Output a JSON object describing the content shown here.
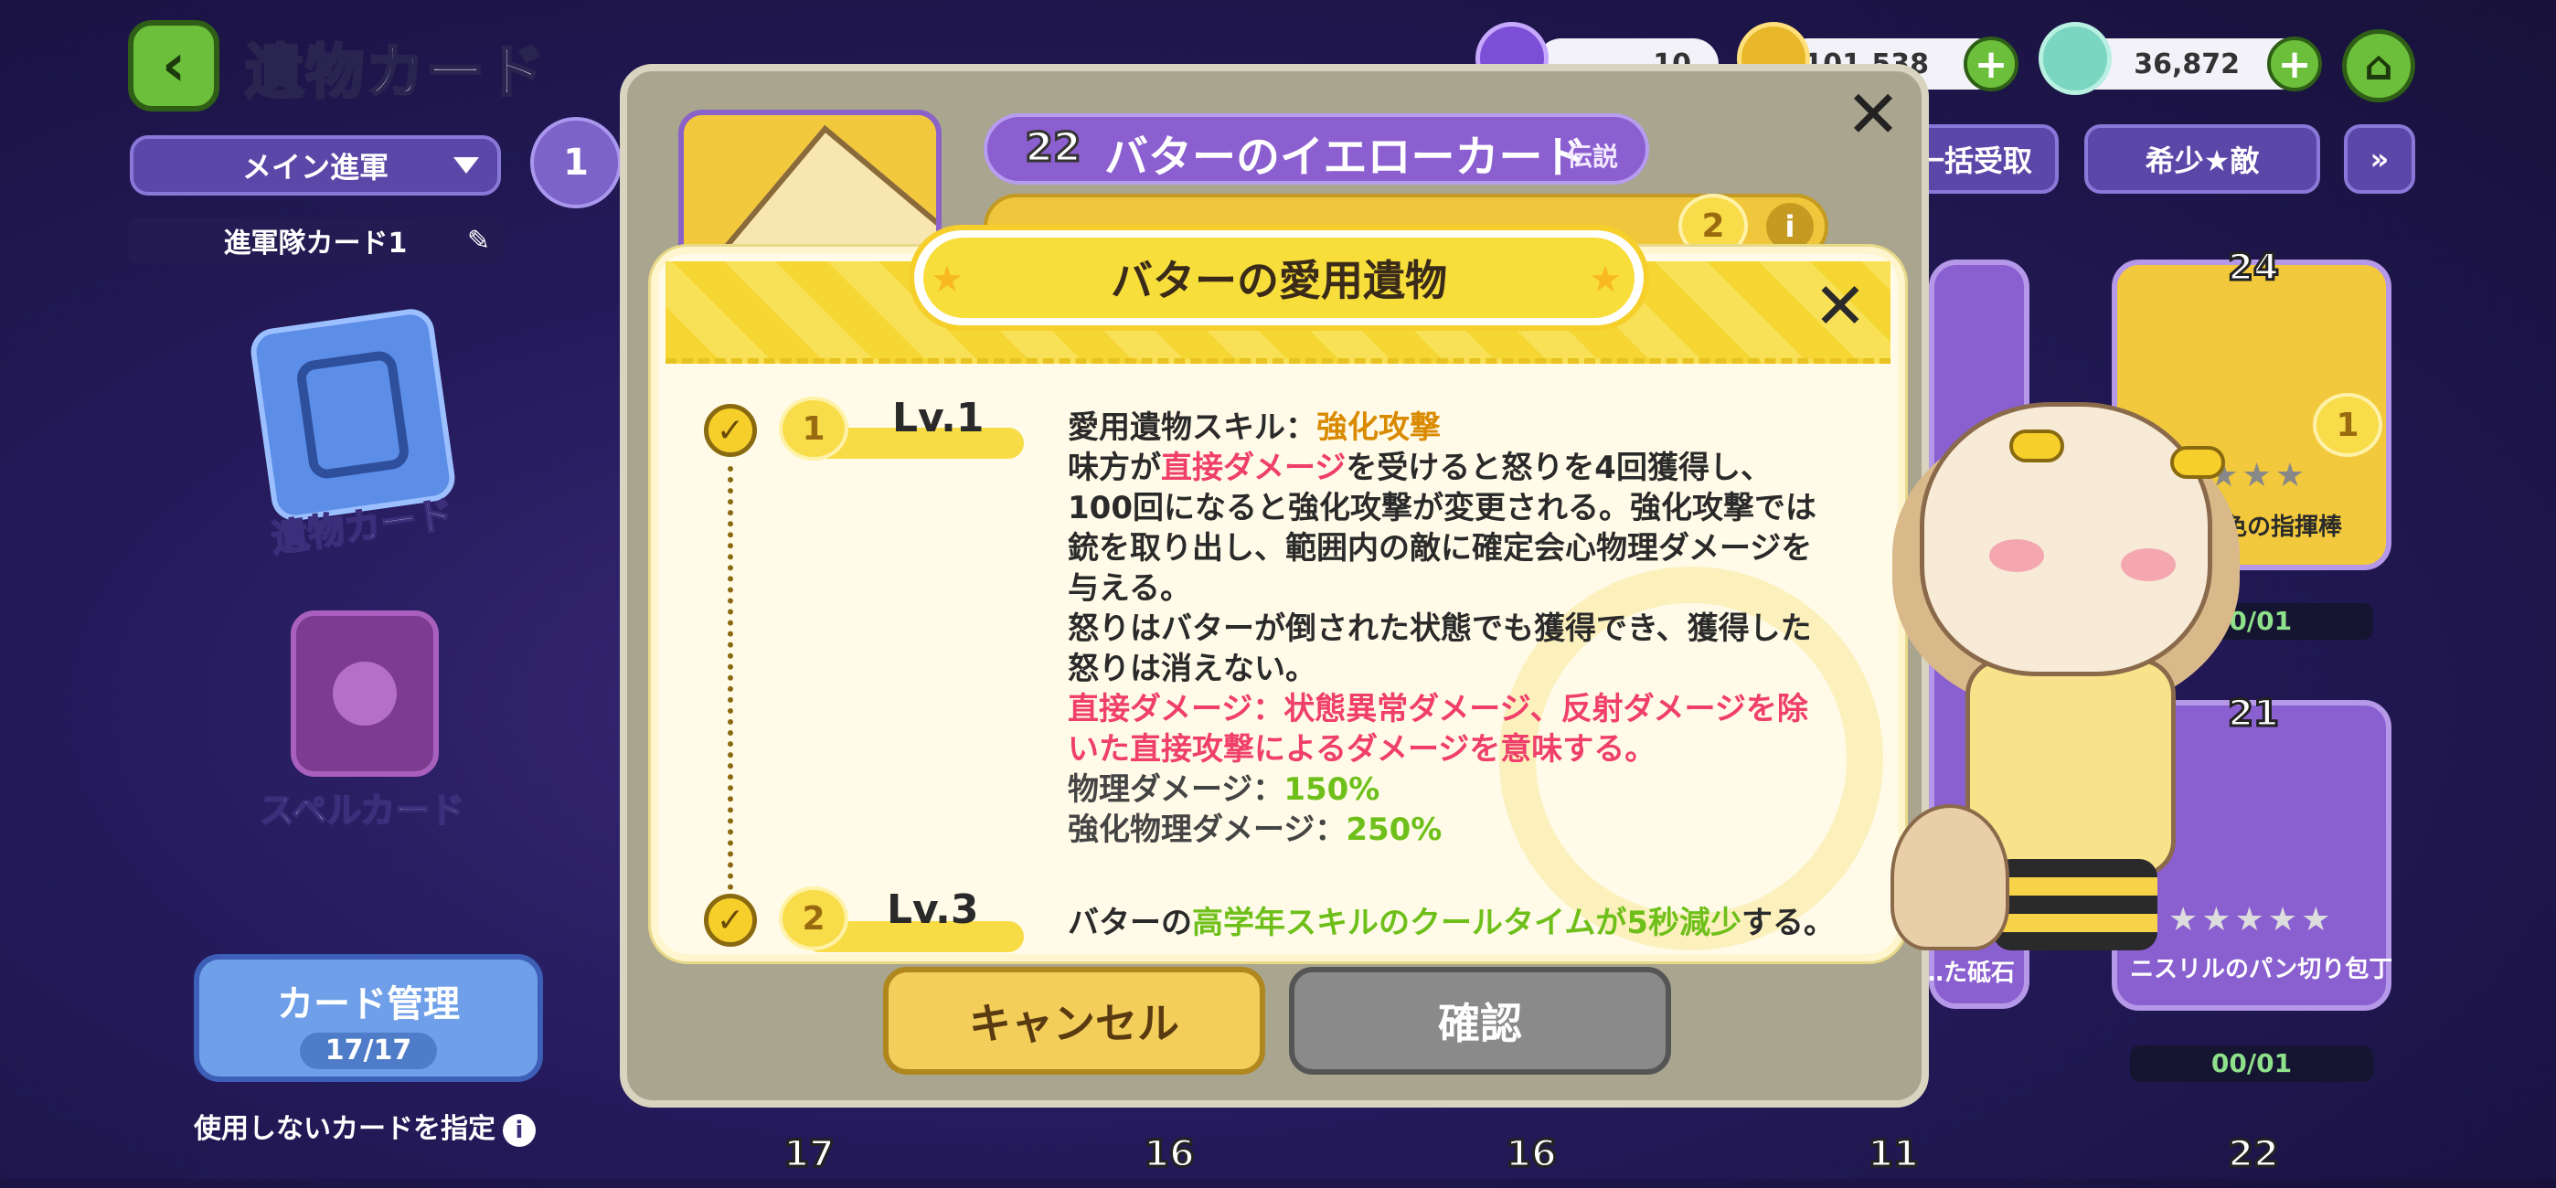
{
  "header": {
    "title": "遺物カード"
  },
  "filter": {
    "selected": "メイン進軍",
    "count": "1"
  },
  "squad": {
    "name": "進軍隊カード1"
  },
  "sidebar": {
    "relic_cards": "遺物カード",
    "spell_cards": "スペルカード"
  },
  "manage": {
    "label": "カード管理",
    "count": "17/17"
  },
  "unused_label": "使用しないカードを指定",
  "currencies": [
    {
      "value": "…10"
    },
    {
      "value": "1,101,538"
    },
    {
      "value": "36,872"
    }
  ],
  "top_buttons": {
    "bulk_receive": "一括受取",
    "rarity_sort": "希少★敵"
  },
  "outer_dialog": {
    "card_level": "22",
    "card_name": "バターのイエローカード",
    "rarity": "伝説",
    "owner_level": "2",
    "cancel": "キャンセル",
    "confirm": "確認"
  },
  "modal": {
    "title": "バターの愛用遺物",
    "levels": [
      {
        "index": "1",
        "label": "Lv.1"
      },
      {
        "index": "2",
        "label": "Lv.3"
      }
    ],
    "skill": {
      "prefix": "愛用遺物スキル：",
      "name": "強化攻撃"
    },
    "desc": {
      "l1_a": "味方が",
      "l1_hl": "直接ダメージ",
      "l1_b": "を受けると怒りを4回獲得し、",
      "l2": "100回になると強化攻撃が変更される。強化攻撃では",
      "l3": "銃を取り出し、範囲内の敵に確定会心物理ダメージを",
      "l4": "与える。",
      "l5": "怒りはバターが倒された状態でも獲得でき、獲得した",
      "l6": "怒りは消えない。",
      "note1": "直接ダメージ：状態異常ダメージ、反射ダメージを除",
      "note2": "いた直接攻撃によるダメージを意味する。",
      "phys_label": "物理ダメージ：",
      "phys_value": "150%",
      "enh_label": "強化物理ダメージ：",
      "enh_value": "250%"
    },
    "lv3": {
      "a": "バターの",
      "hl": "高学年スキルのクールタイムが5秒減少",
      "b": "する。"
    }
  },
  "right_cards": [
    {
      "level": "24",
      "rank": "1",
      "name": "…銀色の指揮棒",
      "progress": "00/01"
    },
    {
      "level": "21",
      "name": "ニスリルのパン切り包丁",
      "progress": "00/01"
    },
    {
      "name": "…た砥石"
    }
  ],
  "bottom_levels": [
    "17",
    "16",
    "16",
    "11",
    "22"
  ],
  "colors": {
    "accent_yellow": "#f8de3a",
    "purple_ui": "#5b47a8",
    "green_button": "#6cbf3a",
    "pink_highlight": "#ef3f6a",
    "value_green": "#6fbf1a"
  }
}
